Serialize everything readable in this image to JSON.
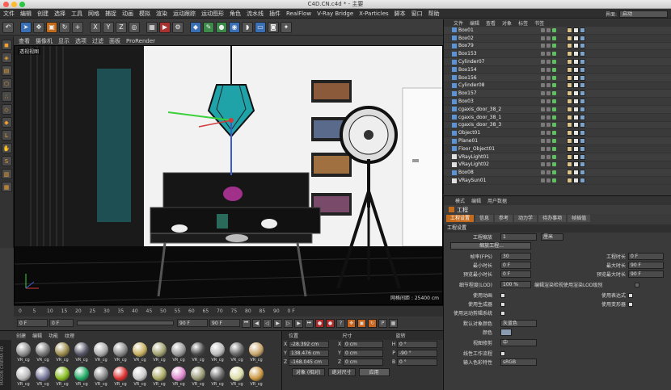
{
  "window": {
    "title": "C4D.CN.c4d * - 主要"
  },
  "menu": [
    "文件",
    "编辑",
    "创建",
    "选择",
    "工具",
    "网格",
    "捕捉",
    "动画",
    "模拟",
    "渲染",
    "运动跟踪",
    "运动图形",
    "角色",
    "流水线",
    "插件",
    "RealFlow",
    "V-Ray Bridge",
    "X-Particles",
    "脚本",
    "窗口",
    "帮助"
  ],
  "layout": {
    "label": "界面:",
    "value": "启动"
  },
  "viewport": {
    "menu": [
      "查看",
      "摄像机",
      "显示",
      "选项",
      "过滤",
      "面板",
      "ProRender"
    ],
    "label": "透视视图",
    "grid_info": "网格间距 : 25400 cm"
  },
  "timeline": {
    "ticks": [
      "0",
      "5",
      "10",
      "15",
      "20",
      "25",
      "30",
      "35",
      "40",
      "45",
      "50",
      "55",
      "60",
      "65",
      "70",
      "75",
      "80",
      "85",
      "90"
    ],
    "end_label": "0 F"
  },
  "playback": {
    "start": "0 F",
    "current": "0 F",
    "end": "90 F",
    "max": "90 F"
  },
  "materials": {
    "menu": [
      "创建",
      "编辑",
      "功能",
      "纹理"
    ],
    "brand": "MAXON CINEMA 4D",
    "items": [
      {
        "label": "VR_cg",
        "color": "#8f8f8f"
      },
      {
        "label": "VR_cg",
        "color": "#777"
      },
      {
        "label": "VR_cg",
        "color": "#9a8a4a"
      },
      {
        "label": "VR_cg",
        "color": "#556"
      },
      {
        "label": "VR_cg",
        "color": "#aaa"
      },
      {
        "label": "VR_cg",
        "color": "#888"
      },
      {
        "label": "VR_cg",
        "color": "#c8b060"
      },
      {
        "label": "VR_cg",
        "color": "#a0a070"
      },
      {
        "label": "VR_cg",
        "color": "#999"
      },
      {
        "label": "VR_cg",
        "color": "#4a4a4a"
      },
      {
        "label": "VR_cg",
        "color": "#bbb"
      },
      {
        "label": "VR_cg",
        "color": "#666"
      },
      {
        "label": "VR_cg",
        "color": "#c9a66b"
      },
      {
        "label": "VR_cg",
        "color": "#bbb"
      },
      {
        "label": "VR_cg",
        "color": "#779"
      },
      {
        "label": "VR_cg",
        "color": "#8b2"
      },
      {
        "label": "VR_cg",
        "color": "#2a6"
      },
      {
        "label": "VR_cg",
        "color": "#888"
      },
      {
        "label": "VR_cg",
        "color": "#d33"
      },
      {
        "label": "VR_cg",
        "color": "#ccc"
      },
      {
        "label": "VR_cg",
        "color": "#aa6"
      },
      {
        "label": "VR_cg",
        "color": "#d8c"
      },
      {
        "label": "VR_cg",
        "color": "#997"
      },
      {
        "label": "VR_cg",
        "color": "#666"
      },
      {
        "label": "VR_cg",
        "color": "#dda"
      },
      {
        "label": "VR_cg",
        "color": "#c94"
      }
    ]
  },
  "coords": {
    "headers": [
      "位置",
      "尺寸",
      "旋转"
    ],
    "rows": [
      {
        "axis": "X",
        "pos": "-28.392 cm",
        "size": "0 cm",
        "rlabel": "H",
        "rot": "0 °"
      },
      {
        "axis": "Y",
        "pos": "138.476 cm",
        "size": "0 cm",
        "rlabel": "P",
        "rot": "-90 °"
      },
      {
        "axis": "Z",
        "pos": "-168.045 cm",
        "size": "0 cm",
        "rlabel": "B",
        "rot": "0 °"
      }
    ],
    "mode": "对象 (相对)",
    "size_mode": "绝对尺寸",
    "apply": "应用"
  },
  "objects": {
    "tabs": [
      "文件",
      "编辑",
      "查看",
      "对象",
      "标签",
      "书签"
    ],
    "items": [
      "Box01",
      "Box02",
      "Box79",
      "Box153",
      "Cylinder07",
      "Box154",
      "Box156",
      "Cylinder08",
      "Box157",
      "Box03",
      "cgaxis_door_38_2",
      "cgaxis_door_38_1",
      "cgaxis_door_38_3",
      "Object01",
      "Plane01",
      "Floor_Object01",
      "VRayLight01",
      "VRayLight02",
      "Box08",
      "VRaySun01"
    ]
  },
  "attributes": {
    "menu": [
      "模式",
      "编辑",
      "用户数据"
    ],
    "title": "工程",
    "tabs": [
      "工程设置",
      "信息",
      "参考",
      "动力学",
      "待办事项",
      "帧插值"
    ],
    "section": "工程设置",
    "scale_label": "工程缩放",
    "scale_value": "1",
    "scale_unit": "厘米",
    "scale_btn": "缩放工程...",
    "fps_label": "帧率(FPS)",
    "fps": "30",
    "duration_label": "工程时长",
    "duration": "0 F",
    "min_label": "最小时长",
    "min": "0 F",
    "max_label": "最大时长",
    "max": "90 F",
    "pmin_label": "预览最小时长",
    "pmin": "0 F",
    "pmax_label": "预览最大时长",
    "pmax": "90 F",
    "lod_label": "细节程度(LOD)",
    "lod": "100 %",
    "lod_render": "编辑渲染检视使用渲染LOD级别",
    "anim_label": "使用动画",
    "expr_label": "使用表达式",
    "gen_label": "使用生成器",
    "deform_label": "使用变形器",
    "motion_label": "使用运动剪辑系统",
    "objcolor_label": "默认对象颜色",
    "objcolor": "灰蓝色",
    "color_label": "颜色",
    "view_label": "视图修剪",
    "view": "中",
    "linear_label": "线性工作流程",
    "input_label": "输入色彩特性",
    "input": "sRGB"
  },
  "colors": {
    "accent": "#c36a1d",
    "viewport_bg": "#0d0d0d",
    "lamp": "#1fa3a8"
  }
}
